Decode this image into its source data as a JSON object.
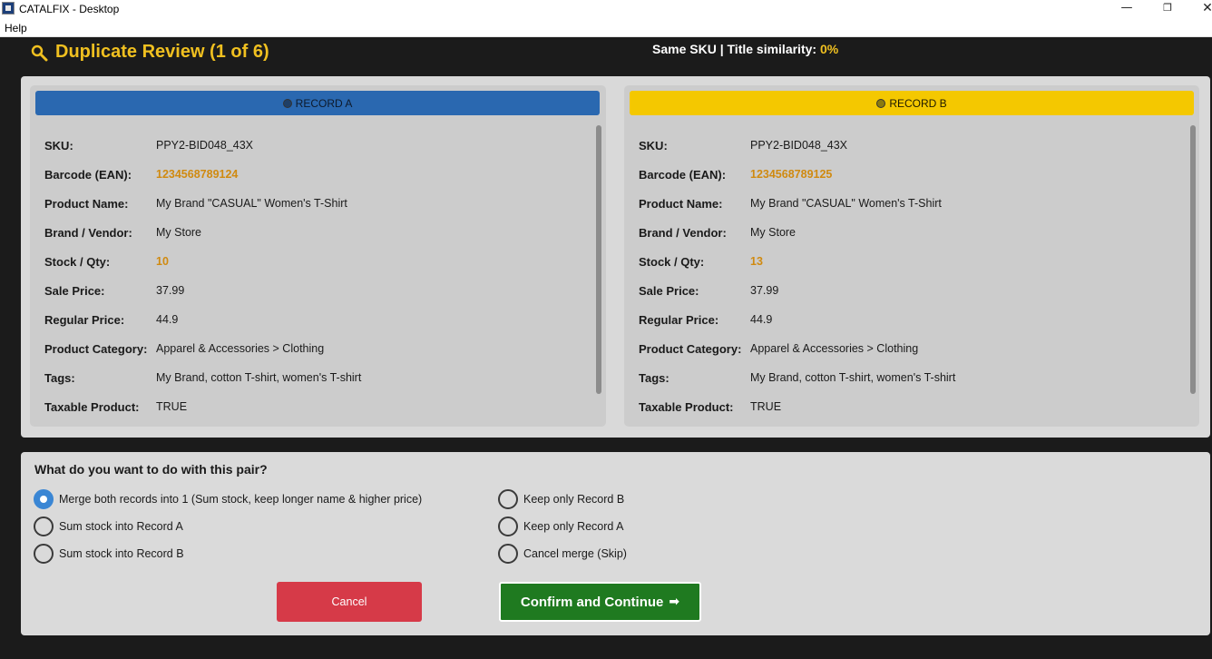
{
  "window": {
    "title": "CATALFIX - Desktop",
    "minimize_glyph": "—",
    "restore_glyph": "❐",
    "close_glyph": "✕"
  },
  "menu": {
    "help": "Help"
  },
  "header": {
    "title": "Duplicate Review (1 of 6)",
    "sku_prefix": "Same SKU | Title similarity:",
    "similarity": "0%",
    "accent_color": "#f0c020"
  },
  "record_a": {
    "title": "RECORD A",
    "header_color": "#2a68b0",
    "fields": [
      {
        "label": "SKU:",
        "value": "PPY2-BID048_43X"
      },
      {
        "label": "Barcode (EAN):",
        "value": "1234568789124"
      },
      {
        "label": "Product Name:",
        "value": "My Brand \"CASUAL\" Women's T-Shirt"
      },
      {
        "label": "Brand / Vendor:",
        "value": "My Store"
      },
      {
        "label": "Stock / Qty:",
        "value": "10"
      },
      {
        "label": "Sale Price:",
        "value": "37.99"
      },
      {
        "label": "Regular Price:",
        "value": "44.9"
      },
      {
        "label": "Product Category:",
        "value": "Apparel & Accessories > Clothing"
      },
      {
        "label": "Tags:",
        "value": "My Brand, cotton T-shirt, women's T-shirt"
      },
      {
        "label": "Taxable Product:",
        "value": "TRUE"
      }
    ]
  },
  "record_b": {
    "title": "RECORD B",
    "header_color": "#f4c800",
    "fields": [
      {
        "label": "SKU:",
        "value": "PPY2-BID048_43X"
      },
      {
        "label": "Barcode (EAN):",
        "value": "1234568789125"
      },
      {
        "label": "Product Name:",
        "value": "My Brand \"CASUAL\" Women's T-Shirt"
      },
      {
        "label": "Brand / Vendor:",
        "value": "My Store"
      },
      {
        "label": "Stock / Qty:",
        "value": "13"
      },
      {
        "label": "Sale Price:",
        "value": "37.99"
      },
      {
        "label": "Regular Price:",
        "value": "44.9"
      },
      {
        "label": "Product Category:",
        "value": "Apparel & Accessories > Clothing"
      },
      {
        "label": "Tags:",
        "value": "My Brand, cotton T-shirt, women's T-shirt"
      },
      {
        "label": "Taxable Product:",
        "value": "TRUE"
      }
    ]
  },
  "highlight_color": "#d08a10",
  "actions": {
    "question": "What do you want to do with this pair?",
    "options": [
      {
        "label": "Merge both records into 1 (Sum stock, keep longer name & higher price)",
        "selected": true
      },
      {
        "label": "Sum stock into Record A",
        "selected": false
      },
      {
        "label": "Sum stock into Record B",
        "selected": false
      },
      {
        "label": "Keep only Record B",
        "selected": false
      },
      {
        "label": "Keep only Record A",
        "selected": false
      },
      {
        "label": "Cancel merge (Skip)",
        "selected": false
      }
    ],
    "cancel_label": "Cancel",
    "confirm_label": "Confirm and Continue",
    "confirm_arrow": "➡",
    "cancel_color": "#d63a48",
    "confirm_color": "#1f7a20"
  }
}
